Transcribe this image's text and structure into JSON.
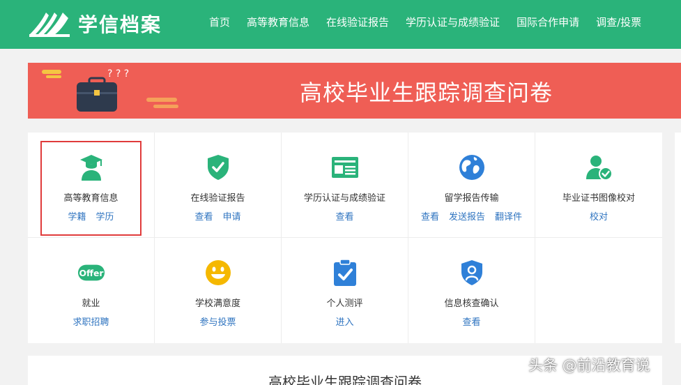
{
  "header": {
    "logo_text": "学信档案",
    "nav": [
      "首页",
      "高等教育信息",
      "在线验证报告",
      "学历认证与成绩验证",
      "国际合作申请",
      "调查/投票"
    ]
  },
  "banner": {
    "title": "高校毕业生跟踪调查问卷",
    "deco_marks": "? ?  ?"
  },
  "services": [
    {
      "title": "高等教育信息",
      "links": [
        "学籍",
        "学历"
      ],
      "icon": "graduate-icon",
      "color": "#2ab37a"
    },
    {
      "title": "在线验证报告",
      "links": [
        "查看",
        "申请"
      ],
      "icon": "shield-check-icon",
      "color": "#2ab37a"
    },
    {
      "title": "学历认证与成绩验证",
      "links": [
        "查看"
      ],
      "icon": "id-card-icon",
      "color": "#2ab37a"
    },
    {
      "title": "留学报告传输",
      "links": [
        "查看",
        "发送报告",
        "翻译件"
      ],
      "icon": "globe-icon",
      "color": "#2f80d8"
    },
    {
      "title": "毕业证书图像校对",
      "links": [
        "校对"
      ],
      "icon": "user-check-icon",
      "color": "#2ab37a"
    },
    {
      "title": "就业",
      "links": [
        "求职招聘"
      ],
      "icon": "offer-icon",
      "color": "#2ab37a",
      "badge": "Offer"
    },
    {
      "title": "学校满意度",
      "links": [
        "参与投票"
      ],
      "icon": "smiley-icon",
      "color": "#f5b800"
    },
    {
      "title": "个人测评",
      "links": [
        "进入"
      ],
      "icon": "clipboard-check-icon",
      "color": "#2f80d8"
    },
    {
      "title": "信息核查确认",
      "links": [
        "查看"
      ],
      "icon": "shield-user-icon",
      "color": "#2f80d8"
    }
  ],
  "bottom": {
    "title": "高校毕业生跟踪调查问卷"
  },
  "watermark": "头条 @前沿教育说"
}
